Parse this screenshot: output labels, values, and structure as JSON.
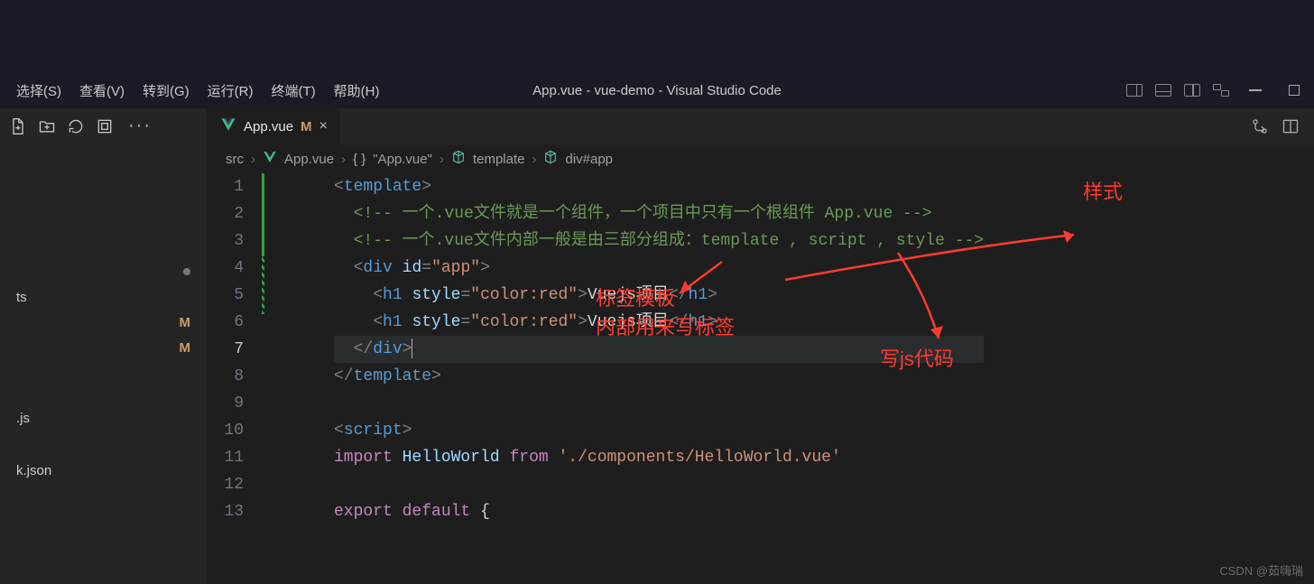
{
  "menubar": {
    "items": [
      "选择(S)",
      "查看(V)",
      "转到(G)",
      "运行(R)",
      "终端(T)",
      "帮助(H)"
    ]
  },
  "window": {
    "title": "App.vue - vue-demo - Visual Studio Code"
  },
  "tab": {
    "filename": "App.vue",
    "modified_badge": "M",
    "close": "×"
  },
  "breadcrumb": {
    "src": "src",
    "file": "App.vue",
    "scope": "\"App.vue\"",
    "t1": "template",
    "t2": "div#app"
  },
  "sidebar": {
    "file1": "ts",
    "file2": "k.json",
    "file_js": ".js"
  },
  "code": {
    "line_numbers": [
      "1",
      "2",
      "3",
      "4",
      "5",
      "6",
      "7",
      "8",
      "9",
      "10",
      "11",
      "12",
      "13"
    ],
    "l1_tag": "template",
    "l2_cmt": "一个.vue文件就是一个组件，一个项目中只有一个根组件 App.vue",
    "l3_cmt": "一个.vue文件内部一般是由三部分组成：template , script , style",
    "l4_tag": "div",
    "l4_attr": "id",
    "l4_val": "\"app\"",
    "l5_tag": "h1",
    "l5_attr": "style",
    "l5_val": "\"color:red\"",
    "l5_text": "Vuejs项目",
    "l6_tag": "h1",
    "l6_attr": "style",
    "l6_val": "\"color:red\"",
    "l6_text": "Vuejs项目",
    "l7_tag": "div",
    "l8_tag": "template",
    "l10_tag": "script",
    "l11_import": "import",
    "l11_name": "HelloWorld",
    "l11_from": "from",
    "l11_path": "'./components/HelloWorld.vue'",
    "l13_export": "export",
    "l13_default": "default"
  },
  "annotations": {
    "a1": "样式",
    "a2": "标签模板",
    "a3": "内部用来写标签",
    "a4": "写js代码"
  },
  "watermark": "CSDN @茹嗨瑞"
}
